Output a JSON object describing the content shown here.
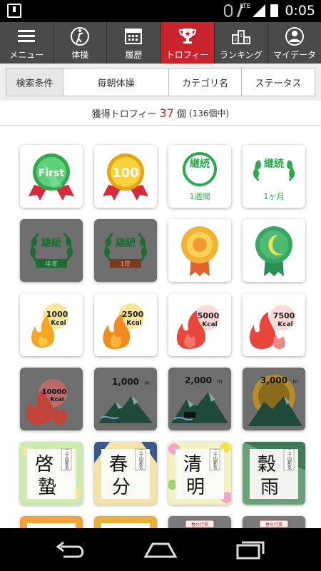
{
  "status_bar": {
    "time": "0:05",
    "network": "LTE"
  },
  "nav": {
    "items": [
      {
        "label": "メニュー",
        "icon": "menu-icon",
        "active": false
      },
      {
        "label": "体操",
        "icon": "exercise-icon",
        "active": false
      },
      {
        "label": "履歴",
        "icon": "calendar-icon",
        "active": false
      },
      {
        "label": "トロフィー",
        "icon": "trophy-icon",
        "active": true
      },
      {
        "label": "ランキング",
        "icon": "podium-icon",
        "active": false
      },
      {
        "label": "マイデータ",
        "icon": "profile-icon",
        "active": false
      }
    ],
    "active_color": "#c9232d"
  },
  "filter": {
    "label": "検索条件",
    "exercise": "毎朝体操",
    "category": "カテゴリ名",
    "status": "ステータス"
  },
  "summary": {
    "prefix": "獲得トロフィー",
    "count": "37",
    "unit": "個",
    "total": "(136個中)"
  },
  "trophies": {
    "first": "First",
    "hundred": "100",
    "keizoku": "継続",
    "one_week": "1週間",
    "one_month": "1ヶ月",
    "half_year": "半年",
    "one_year": "1年",
    "kcal": "Kcal",
    "kcal_1000": "1000",
    "kcal_2500": "2500",
    "kcal_5000": "5000",
    "kcal_7500": "7500",
    "kcal_10000": "10000",
    "m_1000": "1,000",
    "m_2000": "2,000",
    "m_3000": "3,000",
    "m_unit": "m",
    "sekki_tag": "二十四節気",
    "keichitsu_1": "啓",
    "keichitsu_2": "蟄",
    "shunbun_1": "春",
    "shunbun_2": "分",
    "seimei_1": "清",
    "seimei_2": "明",
    "kokuu_1": "穀",
    "kokuu_2": "雨",
    "spring_event": "春の行事"
  }
}
